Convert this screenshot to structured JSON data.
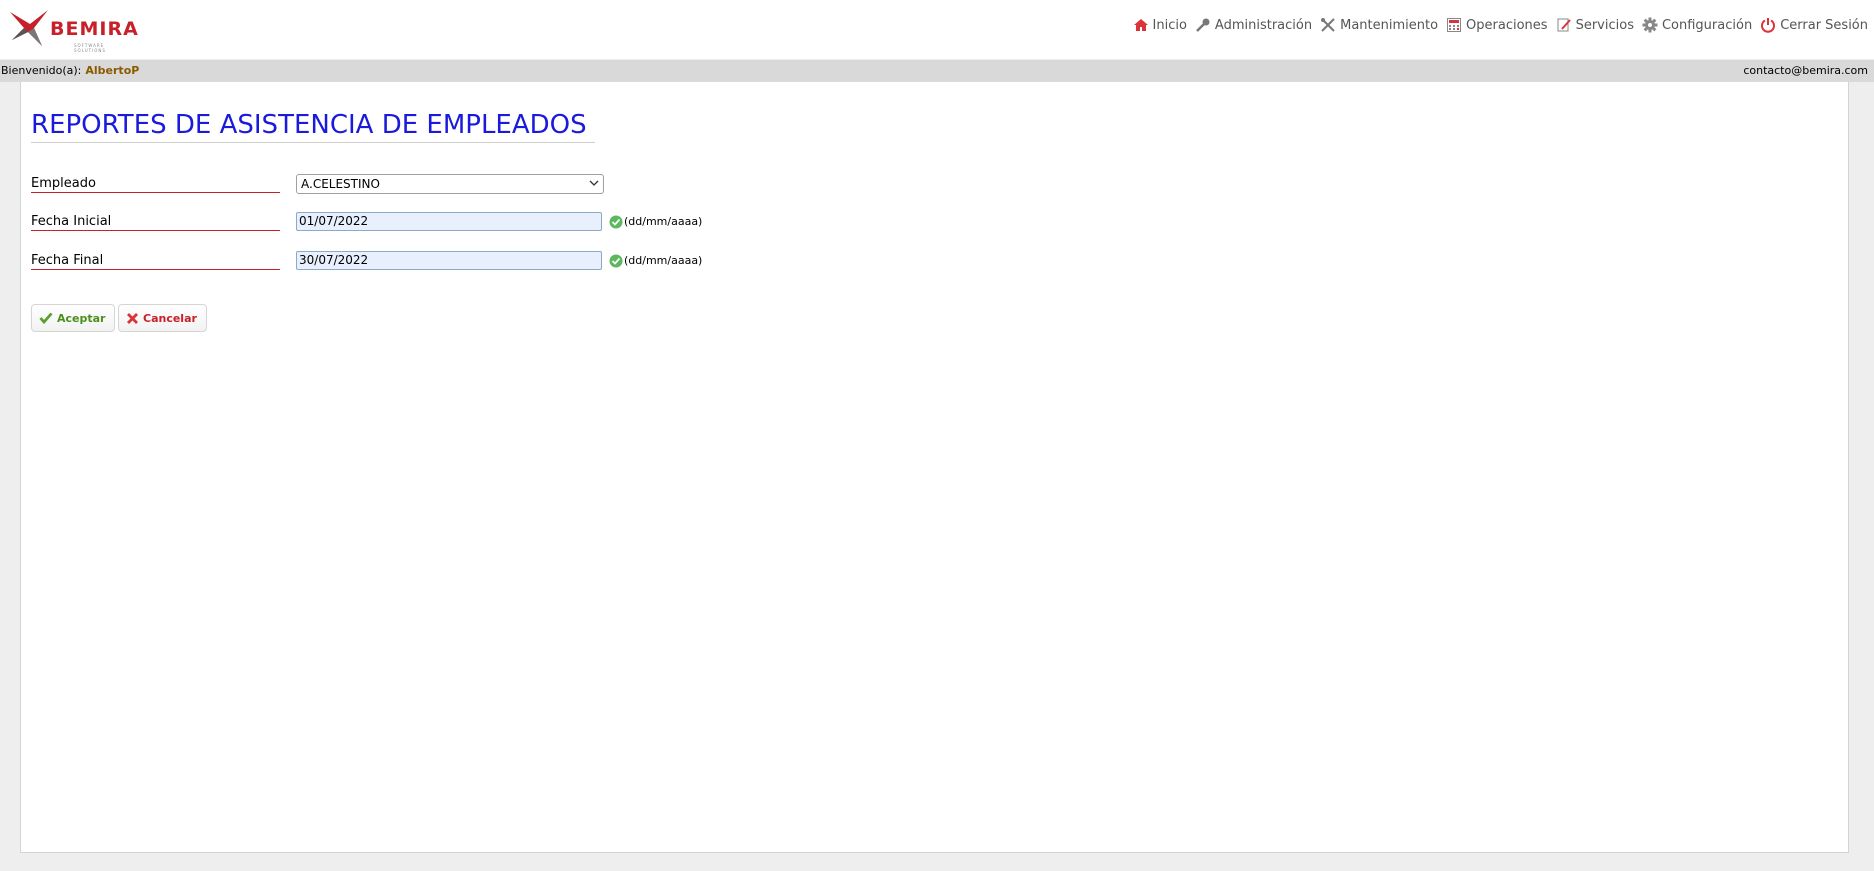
{
  "header": {
    "logo_text": "BEMIRA",
    "logo_subtitle": "SOFTWARE SOLUTIONS",
    "nav": [
      {
        "label": "Inicio",
        "icon": "home-icon"
      },
      {
        "label": "Administración",
        "icon": "key-icon"
      },
      {
        "label": "Mantenimiento",
        "icon": "tools-icon"
      },
      {
        "label": "Operaciones",
        "icon": "calculator-icon"
      },
      {
        "label": "Servicios",
        "icon": "document-edit-icon"
      },
      {
        "label": "Configuración",
        "icon": "gear-icon"
      },
      {
        "label": "Cerrar Sesión",
        "icon": "power-icon"
      }
    ]
  },
  "welcome": {
    "prefix": "Bienvenido(a):",
    "user": "AlbertoP",
    "contact": "contacto@bemira.com"
  },
  "page": {
    "title": "REPORTES DE ASISTENCIA DE EMPLEADOS"
  },
  "form": {
    "employee_label": "Empleado",
    "employee_value": "A.CELESTINO",
    "start_label": "Fecha Inicial",
    "start_value": "01/07/2022",
    "end_label": "Fecha Final",
    "end_value": "30/07/2022",
    "date_format_hint": "(dd/mm/aaaa)"
  },
  "buttons": {
    "accept": "Aceptar",
    "cancel": "Cancelar"
  },
  "colors": {
    "title": "#1a1adc",
    "label_underline": "#c8202a",
    "accept": "#4a8f1d",
    "cancel": "#c8202a",
    "username": "#8b5a00"
  }
}
